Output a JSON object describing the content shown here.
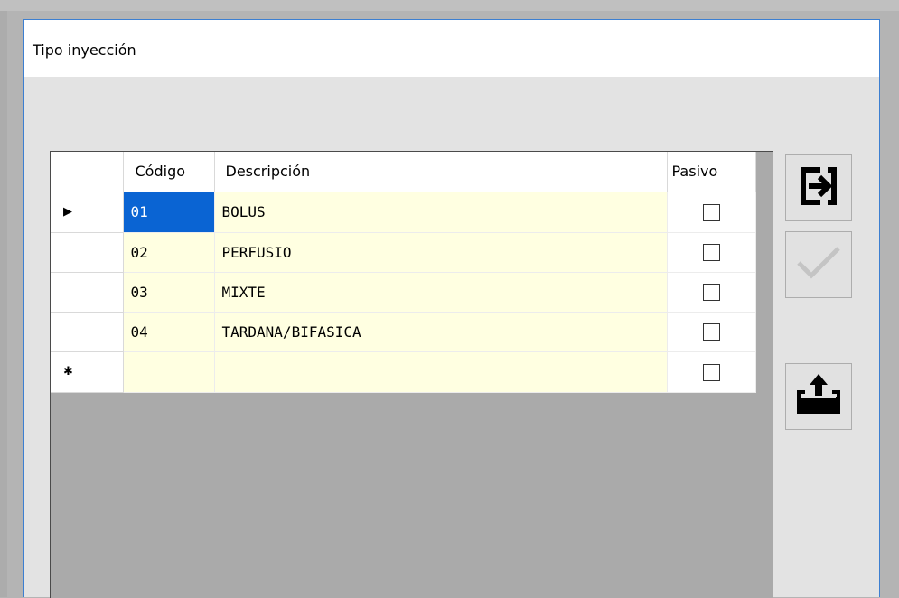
{
  "window": {
    "title": "Tipo inyección"
  },
  "grid": {
    "columns": [
      "Código",
      "Descripción",
      "Pasivo"
    ],
    "rows": [
      {
        "marker": "▶",
        "codigo": "01",
        "descripcion": "BOLUS",
        "pasivo": false,
        "selected": true
      },
      {
        "marker": "",
        "codigo": "02",
        "descripcion": "PERFUSIO",
        "pasivo": false,
        "selected": false
      },
      {
        "marker": "",
        "codigo": "03",
        "descripcion": "MIXTE",
        "pasivo": false,
        "selected": false
      },
      {
        "marker": "",
        "codigo": "04",
        "descripcion": "TARDANA/BIFASICA",
        "pasivo": false,
        "selected": false
      },
      {
        "marker": "✱",
        "codigo": "",
        "descripcion": "",
        "pasivo": false,
        "selected": false
      }
    ]
  },
  "toolbar": {
    "exit_icon": "exit-icon",
    "accept_icon": "checkmark-icon",
    "export_icon": "export-folder-icon"
  },
  "colors": {
    "selection": "#0a64d3",
    "cell_background": "#ffffe1",
    "window_border": "#3c7fd1"
  }
}
